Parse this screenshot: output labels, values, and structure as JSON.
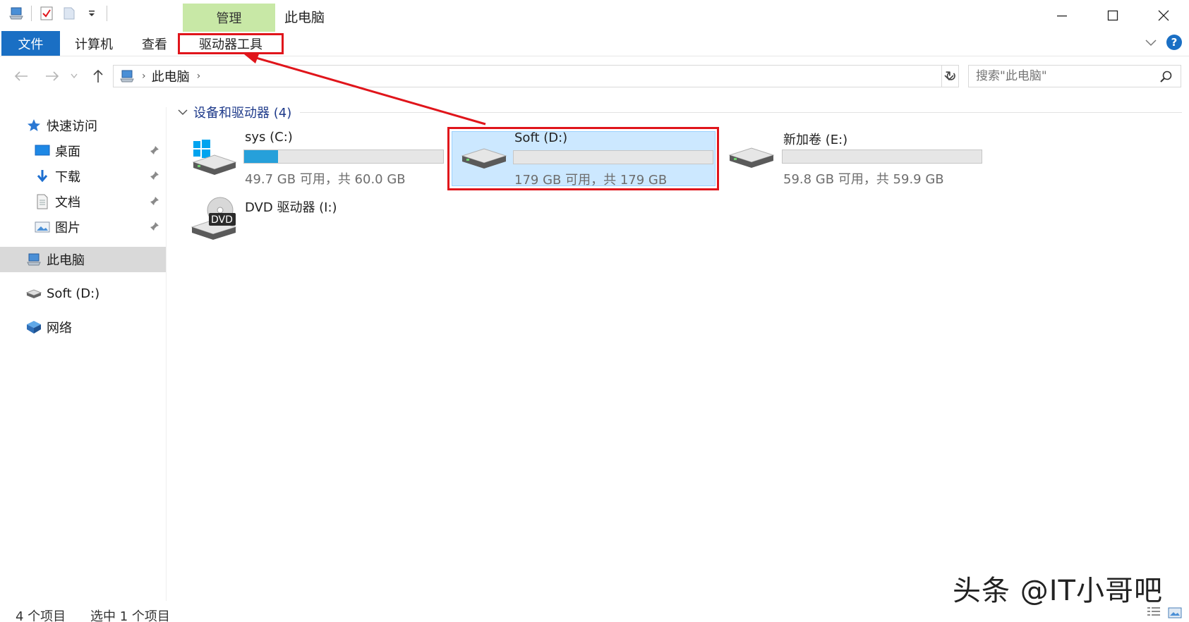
{
  "window": {
    "title": "此电脑",
    "context_tab": "管理"
  },
  "ribbon": {
    "tabs": [
      {
        "label": "文件"
      },
      {
        "label": "计算机"
      },
      {
        "label": "查看"
      },
      {
        "label": "驱动器工具"
      }
    ]
  },
  "address": {
    "crumb": "此电脑",
    "search_placeholder": "搜索\"此电脑\""
  },
  "sidebar": {
    "quick_access": "快速访问",
    "items": [
      {
        "label": "桌面"
      },
      {
        "label": "下载"
      },
      {
        "label": "文档"
      },
      {
        "label": "图片"
      }
    ],
    "this_pc": "此电脑",
    "soft_drive": "Soft (D:)",
    "network": "网络"
  },
  "content": {
    "section_title": "设备和驱动器 (4)",
    "drives": [
      {
        "name": "sys (C:)",
        "free": "49.7 GB 可用，共 60.0 GB",
        "used_fraction": 0.17
      },
      {
        "name": "Soft (D:)",
        "free": "179 GB 可用，共 179 GB",
        "used_fraction": 0.0
      },
      {
        "name": "新加卷 (E:)",
        "free": "59.8 GB 可用，共 59.9 GB",
        "used_fraction": 0.0
      }
    ],
    "dvd": {
      "name": "DVD 驱动器 (I:)",
      "badge": "DVD"
    }
  },
  "status": {
    "count": "4 个项目",
    "selected": "选中 1 个项目"
  },
  "watermark": "头条 @IT小哥吧",
  "colors": {
    "accent": "#1a6fc4",
    "manage_tab": "#c8e8a6",
    "selection": "#cce8ff",
    "annotation": "#e0151b",
    "usage_fill": "#26a0da"
  }
}
